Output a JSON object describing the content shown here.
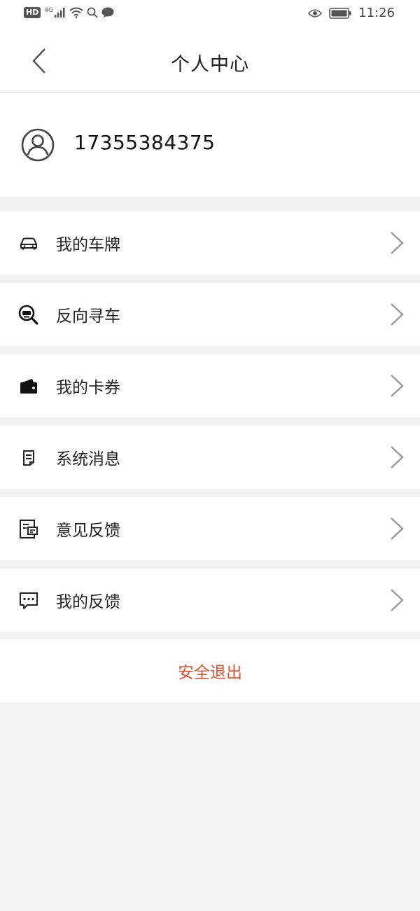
{
  "status_bar": {
    "badge": "HD",
    "network": "4G",
    "time": "11:26"
  },
  "nav": {
    "title": "个人中心",
    "back_icon": "chevron-left-icon"
  },
  "profile": {
    "avatar_icon": "user-circle-icon",
    "phone": "17355384375"
  },
  "menu": [
    {
      "label": "我的车牌",
      "icon": "car-icon"
    },
    {
      "label": "反向寻车",
      "icon": "car-search-icon"
    },
    {
      "label": "我的卡券",
      "icon": "wallet-icon"
    },
    {
      "label": "系统消息",
      "icon": "message-note-icon"
    },
    {
      "label": "意见反馈",
      "icon": "feedback-form-icon"
    },
    {
      "label": "我的反馈",
      "icon": "chat-bubble-icon"
    }
  ],
  "logout": {
    "label": "安全退出",
    "color": "#e0522f"
  },
  "colors": {
    "background": "#f2f2f2",
    "surface": "#ffffff",
    "text": "#222222",
    "chevron": "#9a9a9a"
  }
}
